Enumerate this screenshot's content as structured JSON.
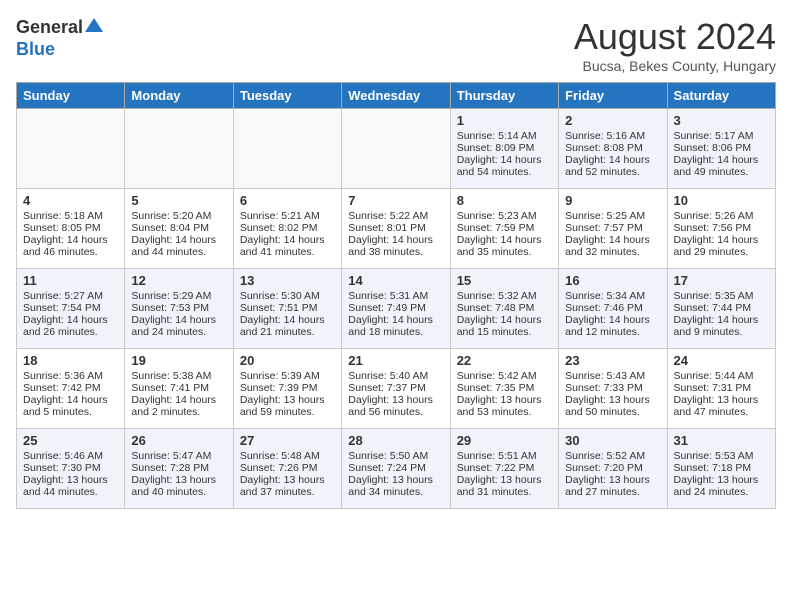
{
  "header": {
    "logo_general": "General",
    "logo_blue": "Blue",
    "title": "August 2024",
    "subtitle": "Bucsa, Bekes County, Hungary"
  },
  "days_of_week": [
    "Sunday",
    "Monday",
    "Tuesday",
    "Wednesday",
    "Thursday",
    "Friday",
    "Saturday"
  ],
  "weeks": [
    [
      {
        "day": "",
        "lines": []
      },
      {
        "day": "",
        "lines": []
      },
      {
        "day": "",
        "lines": []
      },
      {
        "day": "",
        "lines": []
      },
      {
        "day": "1",
        "lines": [
          "Sunrise: 5:14 AM",
          "Sunset: 8:09 PM",
          "Daylight: 14 hours",
          "and 54 minutes."
        ]
      },
      {
        "day": "2",
        "lines": [
          "Sunrise: 5:16 AM",
          "Sunset: 8:08 PM",
          "Daylight: 14 hours",
          "and 52 minutes."
        ]
      },
      {
        "day": "3",
        "lines": [
          "Sunrise: 5:17 AM",
          "Sunset: 8:06 PM",
          "Daylight: 14 hours",
          "and 49 minutes."
        ]
      }
    ],
    [
      {
        "day": "4",
        "lines": [
          "Sunrise: 5:18 AM",
          "Sunset: 8:05 PM",
          "Daylight: 14 hours",
          "and 46 minutes."
        ]
      },
      {
        "day": "5",
        "lines": [
          "Sunrise: 5:20 AM",
          "Sunset: 8:04 PM",
          "Daylight: 14 hours",
          "and 44 minutes."
        ]
      },
      {
        "day": "6",
        "lines": [
          "Sunrise: 5:21 AM",
          "Sunset: 8:02 PM",
          "Daylight: 14 hours",
          "and 41 minutes."
        ]
      },
      {
        "day": "7",
        "lines": [
          "Sunrise: 5:22 AM",
          "Sunset: 8:01 PM",
          "Daylight: 14 hours",
          "and 38 minutes."
        ]
      },
      {
        "day": "8",
        "lines": [
          "Sunrise: 5:23 AM",
          "Sunset: 7:59 PM",
          "Daylight: 14 hours",
          "and 35 minutes."
        ]
      },
      {
        "day": "9",
        "lines": [
          "Sunrise: 5:25 AM",
          "Sunset: 7:57 PM",
          "Daylight: 14 hours",
          "and 32 minutes."
        ]
      },
      {
        "day": "10",
        "lines": [
          "Sunrise: 5:26 AM",
          "Sunset: 7:56 PM",
          "Daylight: 14 hours",
          "and 29 minutes."
        ]
      }
    ],
    [
      {
        "day": "11",
        "lines": [
          "Sunrise: 5:27 AM",
          "Sunset: 7:54 PM",
          "Daylight: 14 hours",
          "and 26 minutes."
        ]
      },
      {
        "day": "12",
        "lines": [
          "Sunrise: 5:29 AM",
          "Sunset: 7:53 PM",
          "Daylight: 14 hours",
          "and 24 minutes."
        ]
      },
      {
        "day": "13",
        "lines": [
          "Sunrise: 5:30 AM",
          "Sunset: 7:51 PM",
          "Daylight: 14 hours",
          "and 21 minutes."
        ]
      },
      {
        "day": "14",
        "lines": [
          "Sunrise: 5:31 AM",
          "Sunset: 7:49 PM",
          "Daylight: 14 hours",
          "and 18 minutes."
        ]
      },
      {
        "day": "15",
        "lines": [
          "Sunrise: 5:32 AM",
          "Sunset: 7:48 PM",
          "Daylight: 14 hours",
          "and 15 minutes."
        ]
      },
      {
        "day": "16",
        "lines": [
          "Sunrise: 5:34 AM",
          "Sunset: 7:46 PM",
          "Daylight: 14 hours",
          "and 12 minutes."
        ]
      },
      {
        "day": "17",
        "lines": [
          "Sunrise: 5:35 AM",
          "Sunset: 7:44 PM",
          "Daylight: 14 hours",
          "and 9 minutes."
        ]
      }
    ],
    [
      {
        "day": "18",
        "lines": [
          "Sunrise: 5:36 AM",
          "Sunset: 7:42 PM",
          "Daylight: 14 hours",
          "and 5 minutes."
        ]
      },
      {
        "day": "19",
        "lines": [
          "Sunrise: 5:38 AM",
          "Sunset: 7:41 PM",
          "Daylight: 14 hours",
          "and 2 minutes."
        ]
      },
      {
        "day": "20",
        "lines": [
          "Sunrise: 5:39 AM",
          "Sunset: 7:39 PM",
          "Daylight: 13 hours",
          "and 59 minutes."
        ]
      },
      {
        "day": "21",
        "lines": [
          "Sunrise: 5:40 AM",
          "Sunset: 7:37 PM",
          "Daylight: 13 hours",
          "and 56 minutes."
        ]
      },
      {
        "day": "22",
        "lines": [
          "Sunrise: 5:42 AM",
          "Sunset: 7:35 PM",
          "Daylight: 13 hours",
          "and 53 minutes."
        ]
      },
      {
        "day": "23",
        "lines": [
          "Sunrise: 5:43 AM",
          "Sunset: 7:33 PM",
          "Daylight: 13 hours",
          "and 50 minutes."
        ]
      },
      {
        "day": "24",
        "lines": [
          "Sunrise: 5:44 AM",
          "Sunset: 7:31 PM",
          "Daylight: 13 hours",
          "and 47 minutes."
        ]
      }
    ],
    [
      {
        "day": "25",
        "lines": [
          "Sunrise: 5:46 AM",
          "Sunset: 7:30 PM",
          "Daylight: 13 hours",
          "and 44 minutes."
        ]
      },
      {
        "day": "26",
        "lines": [
          "Sunrise: 5:47 AM",
          "Sunset: 7:28 PM",
          "Daylight: 13 hours",
          "and 40 minutes."
        ]
      },
      {
        "day": "27",
        "lines": [
          "Sunrise: 5:48 AM",
          "Sunset: 7:26 PM",
          "Daylight: 13 hours",
          "and 37 minutes."
        ]
      },
      {
        "day": "28",
        "lines": [
          "Sunrise: 5:50 AM",
          "Sunset: 7:24 PM",
          "Daylight: 13 hours",
          "and 34 minutes."
        ]
      },
      {
        "day": "29",
        "lines": [
          "Sunrise: 5:51 AM",
          "Sunset: 7:22 PM",
          "Daylight: 13 hours",
          "and 31 minutes."
        ]
      },
      {
        "day": "30",
        "lines": [
          "Sunrise: 5:52 AM",
          "Sunset: 7:20 PM",
          "Daylight: 13 hours",
          "and 27 minutes."
        ]
      },
      {
        "day": "31",
        "lines": [
          "Sunrise: 5:53 AM",
          "Sunset: 7:18 PM",
          "Daylight: 13 hours",
          "and 24 minutes."
        ]
      }
    ]
  ]
}
